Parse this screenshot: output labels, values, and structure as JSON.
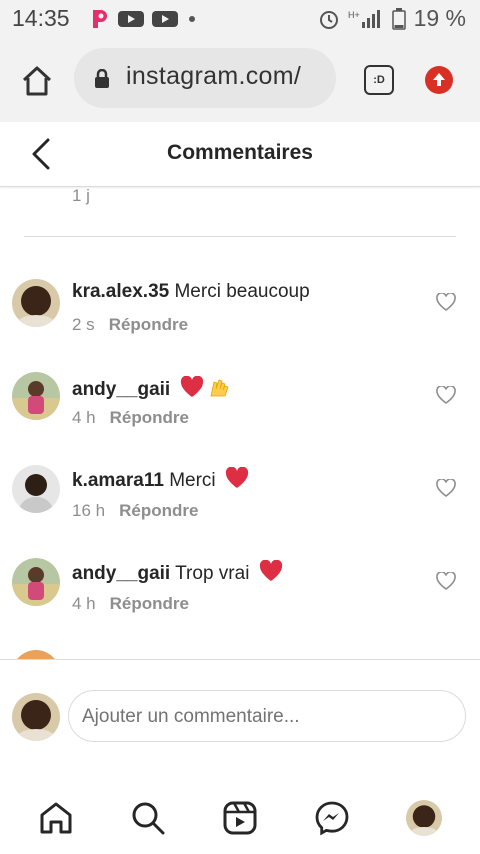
{
  "statusbar": {
    "time": "14:35",
    "battery": "19 %",
    "icons": [
      "p-app-icon",
      "youtube-icon",
      "youtube-icon",
      "dot-icon",
      "alarm-icon",
      "signal-icon",
      "battery-icon"
    ]
  },
  "browser": {
    "url": "instagram.com/",
    "tabs_label": ":D"
  },
  "header": {
    "title": "Commentaires"
  },
  "previous": {
    "time": "1 j"
  },
  "comments": [
    {
      "user": "kra.alex.35",
      "text": " Merci beaucoup",
      "time": "2 s",
      "reply": "Répondre",
      "emoji": ""
    },
    {
      "user": "andy__gaii",
      "text": " ",
      "time": "4 h",
      "reply": "Répondre",
      "emoji": "❤️🙌"
    },
    {
      "user": "k.amara11",
      "text": " Merci ",
      "time": "16 h",
      "reply": "Répondre",
      "emoji": "❤️"
    },
    {
      "user": "andy__gaii",
      "text": " Trop vrai ",
      "time": "4 h",
      "reply": "Répondre",
      "emoji": "❤️"
    }
  ],
  "composer": {
    "placeholder": "Ajouter un commentaire..."
  },
  "colors": {
    "accent_red": "#ed4956",
    "muted_text": "#8e8e8e",
    "divider": "#dbdbdb"
  }
}
